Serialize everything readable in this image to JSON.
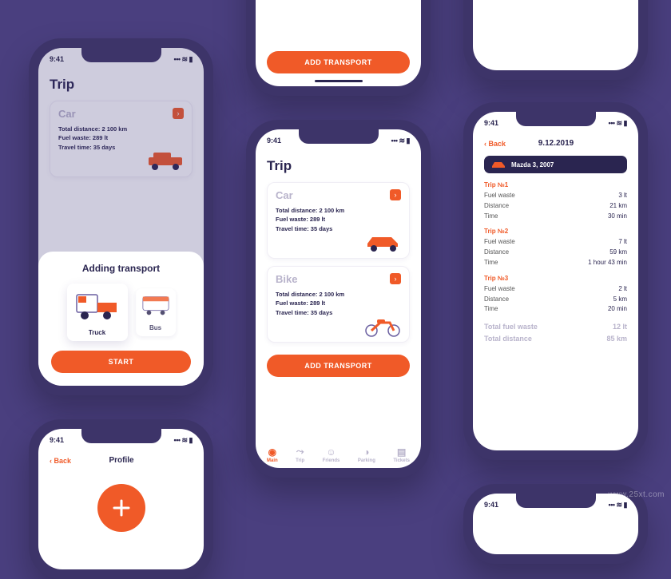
{
  "statusbar": {
    "time": "9:41",
    "indicators": "􀙇 􀛨"
  },
  "buttons": {
    "add_transport": "ADD TRANSPORT",
    "start": "START",
    "back": "Back"
  },
  "sheet": {
    "title": "Adding transport",
    "vehicles": [
      {
        "name": "Truck"
      },
      {
        "name": "Bus"
      }
    ]
  },
  "trip_screen": {
    "title": "Trip",
    "cards": [
      {
        "title": "Car",
        "distance": "Total distance: 2 100 km",
        "fuel": "Fuel waste: 289 lt",
        "time": "Travel time: 35 days"
      },
      {
        "title": "Bike",
        "distance": "Total distance: 2 100 km",
        "fuel": "Fuel waste: 289 lt",
        "time": "Travel time: 35 days"
      }
    ],
    "nav": [
      {
        "label": "Main"
      },
      {
        "label": "Trip"
      },
      {
        "label": "Friends"
      },
      {
        "label": "Parking"
      },
      {
        "label": "Tickets"
      }
    ]
  },
  "detail_screen": {
    "date": "9.12.2019",
    "vehicle": "Mazda 3, 2007",
    "trips": [
      {
        "head": "Trip №1",
        "fuel_l": "Fuel waste",
        "fuel_v": "3 lt",
        "dist_l": "Distance",
        "dist_v": "21 km",
        "time_l": "Time",
        "time_v": "30 min"
      },
      {
        "head": "Trip №2",
        "fuel_l": "Fuel waste",
        "fuel_v": "7 lt",
        "dist_l": "Distance",
        "dist_v": "59 km",
        "time_l": "Time",
        "time_v": "1 hour 43 min"
      },
      {
        "head": "Trip №3",
        "fuel_l": "Fuel waste",
        "fuel_v": "2 lt",
        "dist_l": "Distance",
        "dist_v": "5 km",
        "time_l": "Time",
        "time_v": "20 min"
      }
    ],
    "totals": {
      "fuel_l": "Total fuel waste",
      "fuel_v": "12 lt",
      "dist_l": "Total distance",
      "dist_v": "85 km"
    }
  },
  "profile_screen": {
    "title": "Profile"
  },
  "watermark": "www.25xt.com"
}
